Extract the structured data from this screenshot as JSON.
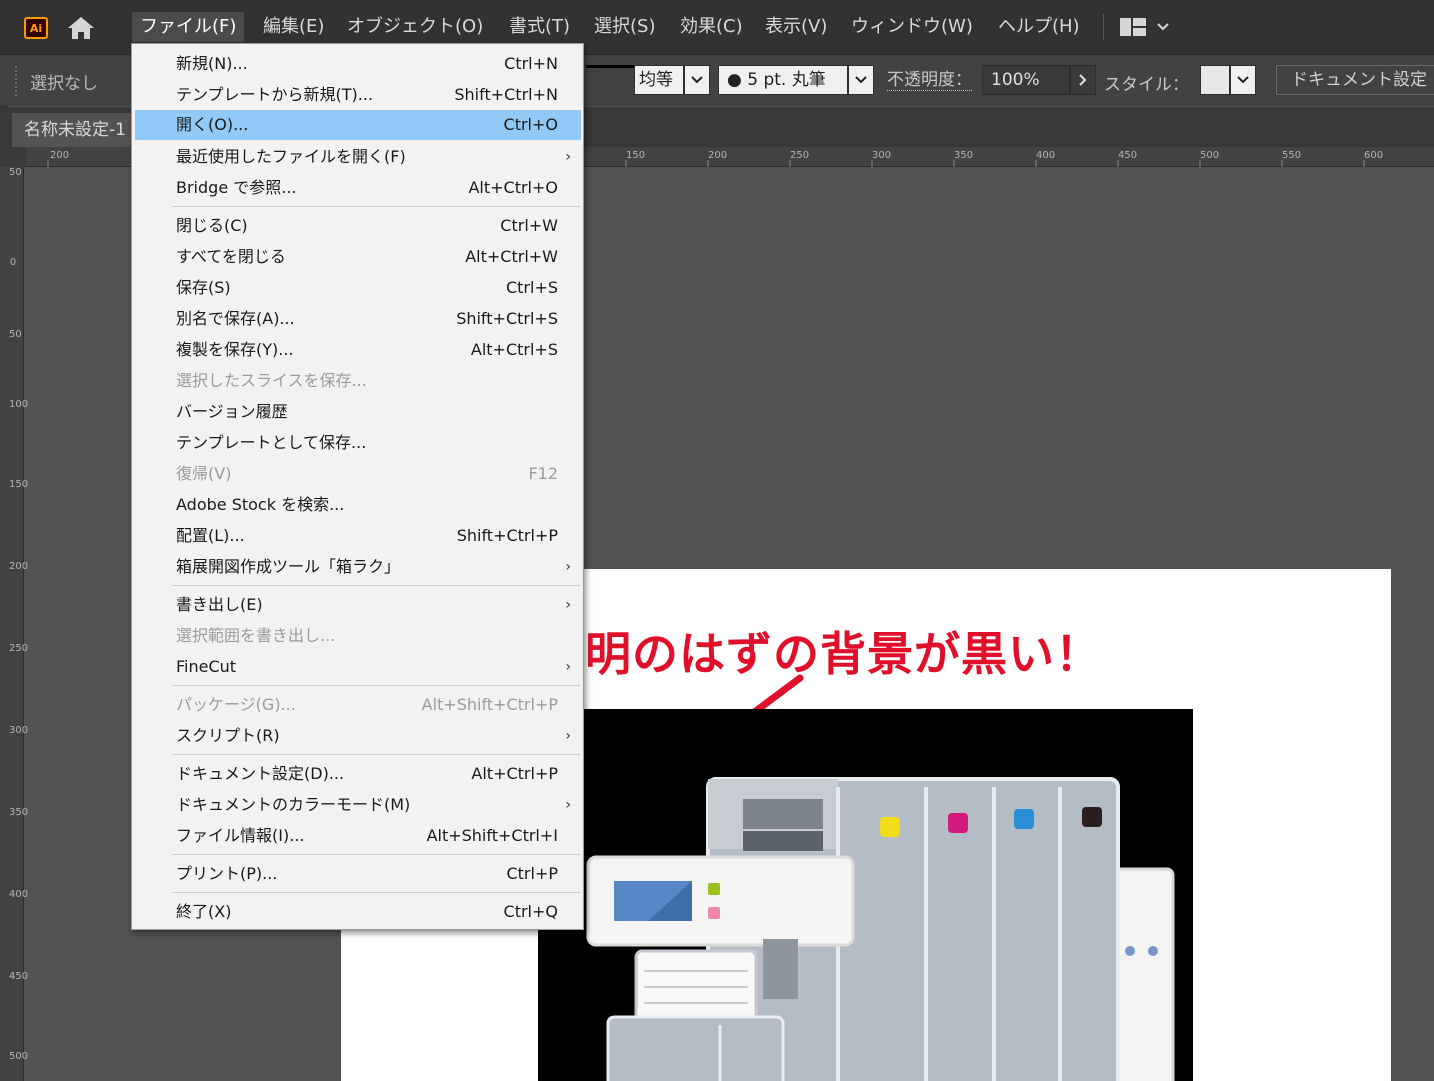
{
  "app": {
    "logo": "Ai",
    "menus": [
      "ファイル(F)",
      "編集(E)",
      "オブジェクト(O)",
      "書式(T)",
      "選択(S)",
      "効果(C)",
      "表示(V)",
      "ウィンドウ(W)",
      "ヘルプ(H)"
    ]
  },
  "controlbar": {
    "selection": "選択なし",
    "stroke_profile": "均等",
    "brush": "● 5 pt. 丸筆",
    "opacity_label": "不透明度：",
    "opacity_value": "100%",
    "style_label": "スタイル：",
    "doc_setup": "ドキュメント設定"
  },
  "tab": {
    "title": "名称未設定-1"
  },
  "rulers": {
    "h_left": "200",
    "h": [
      "150",
      "200",
      "250",
      "300",
      "350",
      "400",
      "450",
      "500",
      "550",
      "600"
    ],
    "v": [
      "50",
      "0",
      "50",
      "100",
      "150",
      "200",
      "250",
      "300",
      "350",
      "400",
      "450",
      "500"
    ]
  },
  "artboard": {
    "annotation": "明のはずの背景が黒い！"
  },
  "file_menu": {
    "items": [
      {
        "label": "新規(N)...",
        "shortcut": "Ctrl+N"
      },
      {
        "label": "テンプレートから新規(T)...",
        "shortcut": "Shift+Ctrl+N"
      },
      {
        "label": "開く(O)...",
        "shortcut": "Ctrl+O"
      },
      {
        "label": "最近使用したファイルを開く(F)",
        "shortcut": ""
      },
      {
        "label": "Bridge で参照...",
        "shortcut": "Alt+Ctrl+O"
      },
      {
        "label": "閉じる(C)",
        "shortcut": "Ctrl+W"
      },
      {
        "label": "すべてを閉じる",
        "shortcut": "Alt+Ctrl+W"
      },
      {
        "label": "保存(S)",
        "shortcut": "Ctrl+S"
      },
      {
        "label": "別名で保存(A)...",
        "shortcut": "Shift+Ctrl+S"
      },
      {
        "label": "複製を保存(Y)...",
        "shortcut": "Alt+Ctrl+S"
      },
      {
        "label": "選択したスライスを保存...",
        "shortcut": ""
      },
      {
        "label": "バージョン履歴",
        "shortcut": ""
      },
      {
        "label": "テンプレートとして保存...",
        "shortcut": ""
      },
      {
        "label": "復帰(V)",
        "shortcut": "F12"
      },
      {
        "label": "Adobe Stock を検索...",
        "shortcut": ""
      },
      {
        "label": "配置(L)...",
        "shortcut": "Shift+Ctrl+P"
      },
      {
        "label": "箱展開図作成ツール「箱ラク」",
        "shortcut": ""
      },
      {
        "label": "書き出し(E)",
        "shortcut": ""
      },
      {
        "label": "選択範囲を書き出し...",
        "shortcut": ""
      },
      {
        "label": "FineCut",
        "shortcut": ""
      },
      {
        "label": "パッケージ(G)...",
        "shortcut": "Alt+Shift+Ctrl+P"
      },
      {
        "label": "スクリプト(R)",
        "shortcut": ""
      },
      {
        "label": "ドキュメント設定(D)...",
        "shortcut": "Alt+Ctrl+P"
      },
      {
        "label": "ドキュメントのカラーモード(M)",
        "shortcut": ""
      },
      {
        "label": "ファイル情報(I)...",
        "shortcut": "Alt+Shift+Ctrl+I"
      },
      {
        "label": "プリント(P)...",
        "shortcut": "Ctrl+P"
      },
      {
        "label": "終了(X)",
        "shortcut": "Ctrl+Q"
      }
    ]
  },
  "colors": {
    "highlight": "#91c9f7",
    "annotation": "#e0102a",
    "ai_brand": "#ff9a00"
  }
}
